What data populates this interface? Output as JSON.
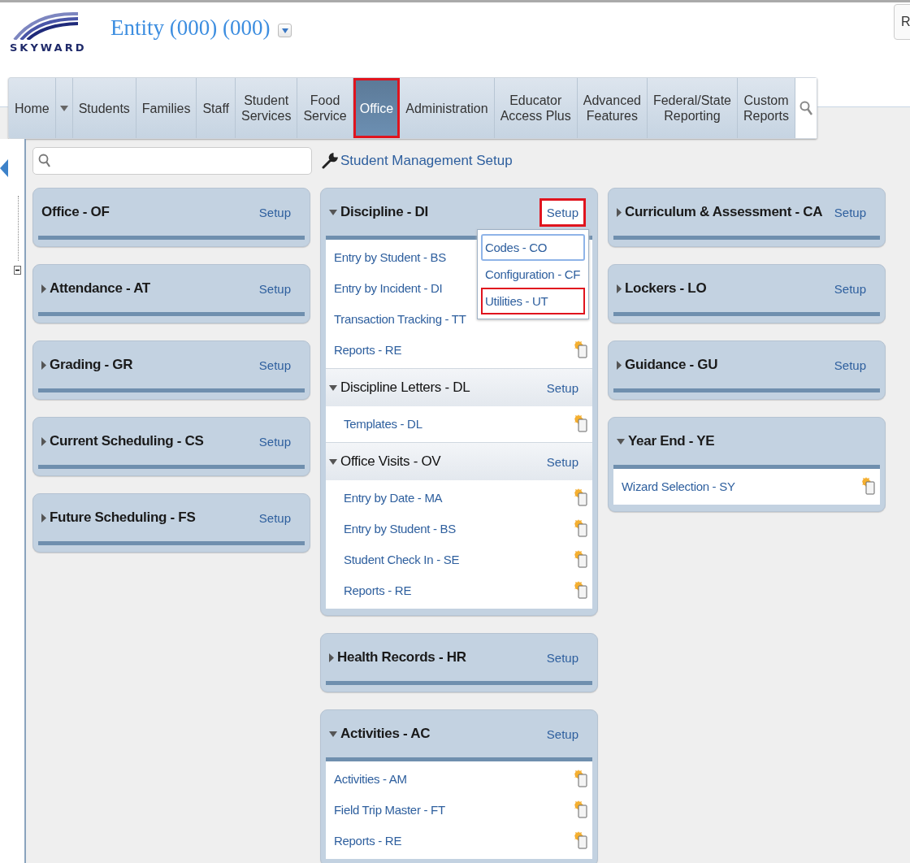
{
  "header": {
    "logo_text": "SKYWARD",
    "entity": "Entity (000) (000)",
    "corner_button": "R"
  },
  "nav": {
    "tabs": [
      {
        "lines": [
          "Home"
        ],
        "selected": false,
        "highlighted": false,
        "dropdown": true
      },
      {
        "lines": [
          "Students"
        ],
        "selected": false,
        "highlighted": false,
        "dropdown": false
      },
      {
        "lines": [
          "Families"
        ],
        "selected": false,
        "highlighted": false,
        "dropdown": false
      },
      {
        "lines": [
          "Staff"
        ],
        "selected": false,
        "highlighted": false,
        "dropdown": false
      },
      {
        "lines": [
          "Student",
          "Services"
        ],
        "selected": false,
        "highlighted": false,
        "dropdown": false
      },
      {
        "lines": [
          "Food",
          "Service"
        ],
        "selected": false,
        "highlighted": false,
        "dropdown": false
      },
      {
        "lines": [
          "Office"
        ],
        "selected": true,
        "highlighted": true,
        "dropdown": false
      },
      {
        "lines": [
          "Administration"
        ],
        "selected": false,
        "highlighted": false,
        "dropdown": false
      },
      {
        "lines": [
          "Educator",
          "Access Plus"
        ],
        "selected": false,
        "highlighted": false,
        "dropdown": false
      },
      {
        "lines": [
          "Advanced",
          "Features"
        ],
        "selected": false,
        "highlighted": false,
        "dropdown": false
      },
      {
        "lines": [
          "Federal/State",
          "Reporting"
        ],
        "selected": false,
        "highlighted": false,
        "dropdown": false
      },
      {
        "lines": [
          "Custom",
          "Reports"
        ],
        "selected": false,
        "highlighted": false,
        "dropdown": false
      }
    ]
  },
  "setup_link": "Student Management Setup",
  "columns": [
    [
      {
        "sections": [
          {
            "title": "Office - OF",
            "toggle": false,
            "setup": "Setup",
            "highlighted": false
          }
        ]
      },
      {
        "sections": [
          {
            "title": "Attendance - AT",
            "toggle": true,
            "expanded": false,
            "setup": "Setup",
            "highlighted": false
          }
        ]
      },
      {
        "sections": [
          {
            "title": "Grading - GR",
            "toggle": true,
            "expanded": false,
            "setup": "Setup",
            "highlighted": false
          }
        ]
      },
      {
        "sections": [
          {
            "title": "Current Scheduling - CS",
            "toggle": true,
            "expanded": false,
            "setup": "Setup",
            "highlighted": false
          }
        ]
      },
      {
        "sections": [
          {
            "title": "Future Scheduling - FS",
            "toggle": true,
            "expanded": false,
            "setup": "Setup",
            "highlighted": false
          }
        ]
      }
    ],
    [
      {
        "sections": [
          {
            "title": "Discipline - DI",
            "toggle": true,
            "expanded": true,
            "setup": "Setup",
            "highlighted": true,
            "menu": [
              {
                "label": "Codes - CO",
                "focused": true,
                "highlighted": false
              },
              {
                "label": "Configuration - CF",
                "focused": false,
                "highlighted": false
              },
              {
                "label": "Utilities - UT",
                "focused": false,
                "highlighted": true
              }
            ],
            "items": [
              {
                "label": "Entry by Student - BS",
                "icon": false
              },
              {
                "label": "Entry by Incident - DI",
                "icon": false
              },
              {
                "label": "Transaction Tracking - TT",
                "icon": false
              },
              {
                "label": "Reports - RE",
                "icon": true
              }
            ]
          },
          {
            "title": "Discipline Letters - DL",
            "toggle": true,
            "expanded": true,
            "setup": "Setup",
            "highlighted": false,
            "items": [
              {
                "label": "Templates - DL",
                "icon": true
              }
            ]
          },
          {
            "title": "Office Visits - OV",
            "toggle": true,
            "expanded": true,
            "setup": "Setup",
            "highlighted": false,
            "items": [
              {
                "label": "Entry by Date - MA",
                "icon": true
              },
              {
                "label": "Entry by Student - BS",
                "icon": true
              },
              {
                "label": "Student Check In - SE",
                "icon": true
              },
              {
                "label": "Reports - RE",
                "icon": true
              }
            ]
          }
        ]
      },
      {
        "sections": [
          {
            "title": "Health Records - HR",
            "toggle": true,
            "expanded": false,
            "setup": "Setup",
            "highlighted": false
          }
        ]
      },
      {
        "sections": [
          {
            "title": "Activities - AC",
            "toggle": true,
            "expanded": true,
            "setup": "Setup",
            "highlighted": false,
            "items": [
              {
                "label": "Activities - AM",
                "icon": true
              },
              {
                "label": "Field Trip Master - FT",
                "icon": true
              },
              {
                "label": "Reports - RE",
                "icon": true
              }
            ]
          }
        ]
      }
    ],
    [
      {
        "sections": [
          {
            "title": "Curriculum & Assessment - CA",
            "toggle": true,
            "expanded": false,
            "setup": "Setup",
            "highlighted": false
          }
        ]
      },
      {
        "sections": [
          {
            "title": "Lockers - LO",
            "toggle": true,
            "expanded": false,
            "setup": "Setup",
            "highlighted": false
          }
        ]
      },
      {
        "sections": [
          {
            "title": "Guidance - GU",
            "toggle": true,
            "expanded": false,
            "setup": "Setup",
            "highlighted": false
          }
        ]
      },
      {
        "sections": [
          {
            "title": "Year End - YE",
            "toggle": true,
            "expanded": true,
            "items": [
              {
                "label": "Wizard Selection - SY",
                "icon": true
              }
            ]
          }
        ]
      }
    ]
  ]
}
